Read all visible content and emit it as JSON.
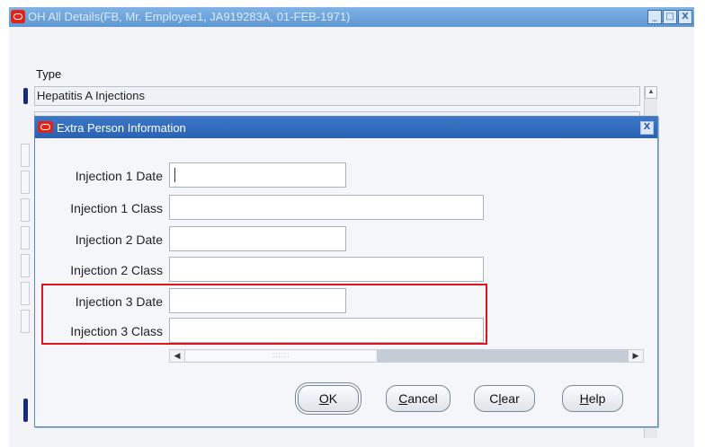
{
  "outer_window": {
    "title": "OH All Details(FB, Mr. Employee1, JA919283A, 01-FEB-1971)",
    "controls": {
      "minimize": "_",
      "maximize": "□",
      "close": "X"
    }
  },
  "type_section": {
    "label": "Type",
    "first_value": "Hepatitis A Injections"
  },
  "dialog": {
    "title": "Extra Person Information",
    "close": "X",
    "fields": [
      {
        "label": "Injection 1 Date",
        "value": ""
      },
      {
        "label": "Injection 1 Class",
        "value": ""
      },
      {
        "label": "Injection 2 Date",
        "value": ""
      },
      {
        "label": "Injection 2 Class",
        "value": ""
      },
      {
        "label": "Injection 3 Date",
        "value": ""
      },
      {
        "label": "Injection 3 Class",
        "value": ""
      }
    ],
    "buttons": {
      "ok": {
        "underlined": "O",
        "rest": "K"
      },
      "cancel": {
        "underlined": "C",
        "rest": "ancel"
      },
      "clear": {
        "pre": "C",
        "underlined": "l",
        "rest": "ear"
      },
      "help": {
        "underlined": "H",
        "rest": "elp"
      }
    }
  },
  "colors": {
    "highlight": "#e0141e",
    "title_bar": "#2a62b2",
    "oracle_red": "#e0241a"
  }
}
